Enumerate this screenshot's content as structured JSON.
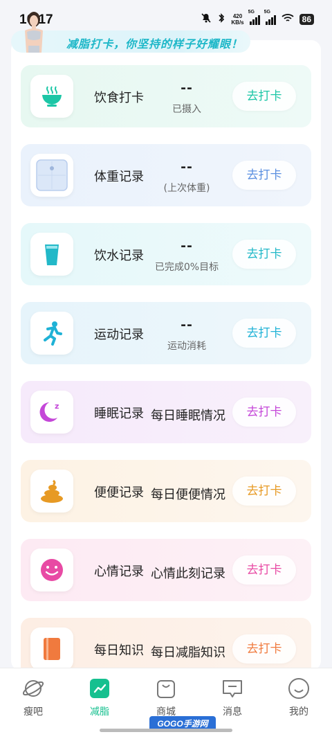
{
  "status_bar": {
    "time": "10:17",
    "net_speed_value": "420",
    "net_speed_unit": "KB/s",
    "signal1_tag": "5G",
    "signal2_tag": "5G",
    "battery": "86"
  },
  "banner": {
    "text": "减脂打卡，你坚持的样子好耀眼！"
  },
  "cards": [
    {
      "title": "饮食打卡",
      "value": "--",
      "sub": "已摄入",
      "button": "去打卡",
      "accent": "#1cc6a6",
      "bg_from": "#e7f8f1",
      "bg_to": "#eefaf7",
      "icon": "bowl-icon"
    },
    {
      "title": "体重记录",
      "value": "--",
      "sub": "(上次体重)",
      "button": "去打卡",
      "accent": "#5a8fe0",
      "bg_from": "#eaf2fc",
      "bg_to": "#f0f5fc",
      "icon": "scale-icon"
    },
    {
      "title": "饮水记录",
      "value": "--",
      "sub": "已完成0%目标",
      "button": "去打卡",
      "accent": "#22b8c8",
      "bg_from": "#e5f8fa",
      "bg_to": "#eefafb",
      "icon": "water-cup-icon"
    },
    {
      "title": "运动记录",
      "value": "--",
      "sub": "运动消耗",
      "button": "去打卡",
      "accent": "#1fb2d6",
      "bg_from": "#e6f4fb",
      "bg_to": "#eef7fb",
      "icon": "running-icon"
    },
    {
      "title": "睡眠记录",
      "desc": "每日睡眠情况",
      "button": "去打卡",
      "accent": "#c447d8",
      "bg_from": "#f6eafb",
      "bg_to": "#f8f0fb",
      "icon": "moon-icon"
    },
    {
      "title": "便便记录",
      "desc": "每日便便情况",
      "button": "去打卡",
      "accent": "#e79a24",
      "bg_from": "#fdf2e4",
      "bg_to": "#fdf6ee",
      "icon": "poop-icon"
    },
    {
      "title": "心情记录",
      "desc": "心情此刻记录",
      "button": "去打卡",
      "accent": "#e84aa4",
      "bg_from": "#fdeaf3",
      "bg_to": "#fdf1f6",
      "icon": "smile-icon"
    },
    {
      "title": "每日知识",
      "desc": "每日减脂知识",
      "button": "去打卡",
      "accent": "#f07a3e",
      "bg_from": "#fdeee4",
      "bg_to": "#fdf3ec",
      "icon": "book-icon"
    }
  ],
  "bottom_nav": [
    {
      "label": "瘦吧",
      "icon": "planet-icon"
    },
    {
      "label": "减脂",
      "icon": "chart-icon",
      "active": true
    },
    {
      "label": "商城",
      "icon": "shopping-bag-icon"
    },
    {
      "label": "消息",
      "icon": "message-icon"
    },
    {
      "label": "我的",
      "icon": "profile-smile-icon"
    }
  ],
  "watermark": "GOGO手游网",
  "colors": {
    "active_nav": "#16c08f",
    "banner_text": "#1db7c8"
  }
}
